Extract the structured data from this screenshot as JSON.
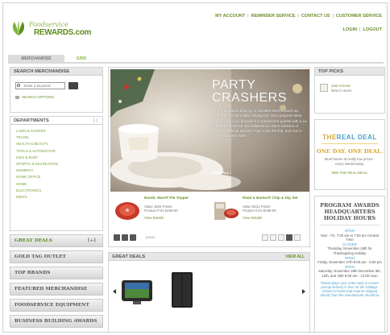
{
  "header": {
    "logo_line1": "Foodservice",
    "logo_line2": "REWARDS.com",
    "nav": [
      "MY ACCOUNT",
      "REMINDER SERVICE",
      "CONTACT US",
      "CUSTOMER SERVICE"
    ],
    "login": "LOGIN",
    "logout": "LOGOUT"
  },
  "tabs": {
    "merchandise": "MERCHANDISE",
    "grid": "GRID"
  },
  "search": {
    "title": "SEARCH MERCHANDISE",
    "placeholder": "Enter a keyword",
    "options": "SEARCH OPTIONS"
  },
  "departments": {
    "title": "DEPARTMENTS",
    "toggle": "[-]",
    "items": [
      "LAWN & GARDEN",
      "TRAVEL",
      "HEALTH & BEAUTY",
      "TOOLS & AUTOMOTIVE",
      "KIDS & BABY",
      "SPORTS & RECREATION",
      "WOMEN'S",
      "HOME OFFICE",
      "HOME",
      "ELECTRONICS",
      "MEN'S"
    ]
  },
  "side_buttons": {
    "great_deals": "GREAT DEALS",
    "great_deals_toggle": "[+]",
    "gold_tag": "GOLD TAG OUTLET",
    "top_brands": "TOP BRANDS",
    "featured": "FEATURED MERCHANDISE",
    "equipment": "FOODSERVICE EQUIPMENT",
    "business": "BUSINESS BUILDING AWARDS"
  },
  "hero": {
    "title_line1": "PARTY",
    "title_line2": "CRASHERS",
    "body": "When neighbors drop by or carolers seek a warm-up, invite them in for a little holiday fun. Your program Web site can help you prepare for unexpected guests with a Le Creuset Casserole, Rochdale Bocci Wine Glasses or Willow Arbelsine Divided Tray. Click the link, and mix in the season with style.",
    "view_all": "VIEW ALL"
  },
  "products": [
    {
      "name": "Nordic Ware® Pie Topper",
      "value": "Value 1825 Points",
      "number": "Product #:01-5458-00",
      "view": "View Details"
    },
    {
      "name": "Reed & Barton® Chip & Dip Set",
      "value": "Value 8231 Points",
      "number": "Product #:01-8198-00",
      "view": "View Details"
    }
  ],
  "slider": {
    "pause_label": "pause"
  },
  "great_deals": {
    "title": "GREAT DEALS",
    "view_all": "VIEW ALL"
  },
  "top_picks": {
    "title": "TOP PICKS",
    "line1": "Just Arrived",
    "line2": "New in stock"
  },
  "real_deal": {
    "logo_the": "THE",
    "logo_main": "REAL DEAL",
    "tagline": "ONE DAY. ONE DEAL.",
    "sub": "Must-haves at really low prices - every Wednesday.",
    "button": "SEE THE REAL DEAL!"
  },
  "program": {
    "title": "PROGRAM AWARDS HEADQUARTERS HOLIDAY HOURS",
    "entries": [
      {
        "status": "OPEN",
        "text": "Mon - Fri, 7:00 am to 7:00 pm Central Time"
      },
      {
        "status": "CLOSED",
        "text": "Thursday, November 26th for Thanksgiving Holiday"
      },
      {
        "status": "OPEN",
        "text": "Friday, November 27th 8:00 am - 5:00 pm"
      },
      {
        "status": "OPEN",
        "text": "Saturday, November 28th December 5th, 12th, and 19th 8:00 am - 12:00 noon"
      }
    ],
    "note": "Please place your order early to ensure prompt delivery in time for the holidays. Orders for items that must be shipped directly from the manufacturer should be"
  }
}
